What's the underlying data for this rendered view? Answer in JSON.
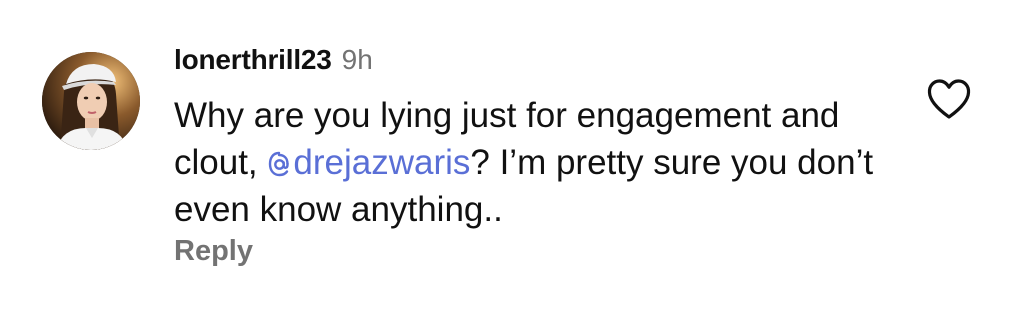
{
  "comment": {
    "username": "lonerthrill23",
    "timestamp": "9h",
    "text_before_mention": "Why are you lying just for engagement and clout, ",
    "mention": "drejazwaris",
    "text_after_mention": "? I’m pretty sure you don’t even know anything..",
    "reply_label": "Reply"
  },
  "icons": {
    "mention": "threads-at-icon",
    "like": "heart-outline-icon"
  },
  "colors": {
    "mention": "#5a6fd6",
    "secondary_text": "#737373",
    "primary_text": "#111111"
  }
}
